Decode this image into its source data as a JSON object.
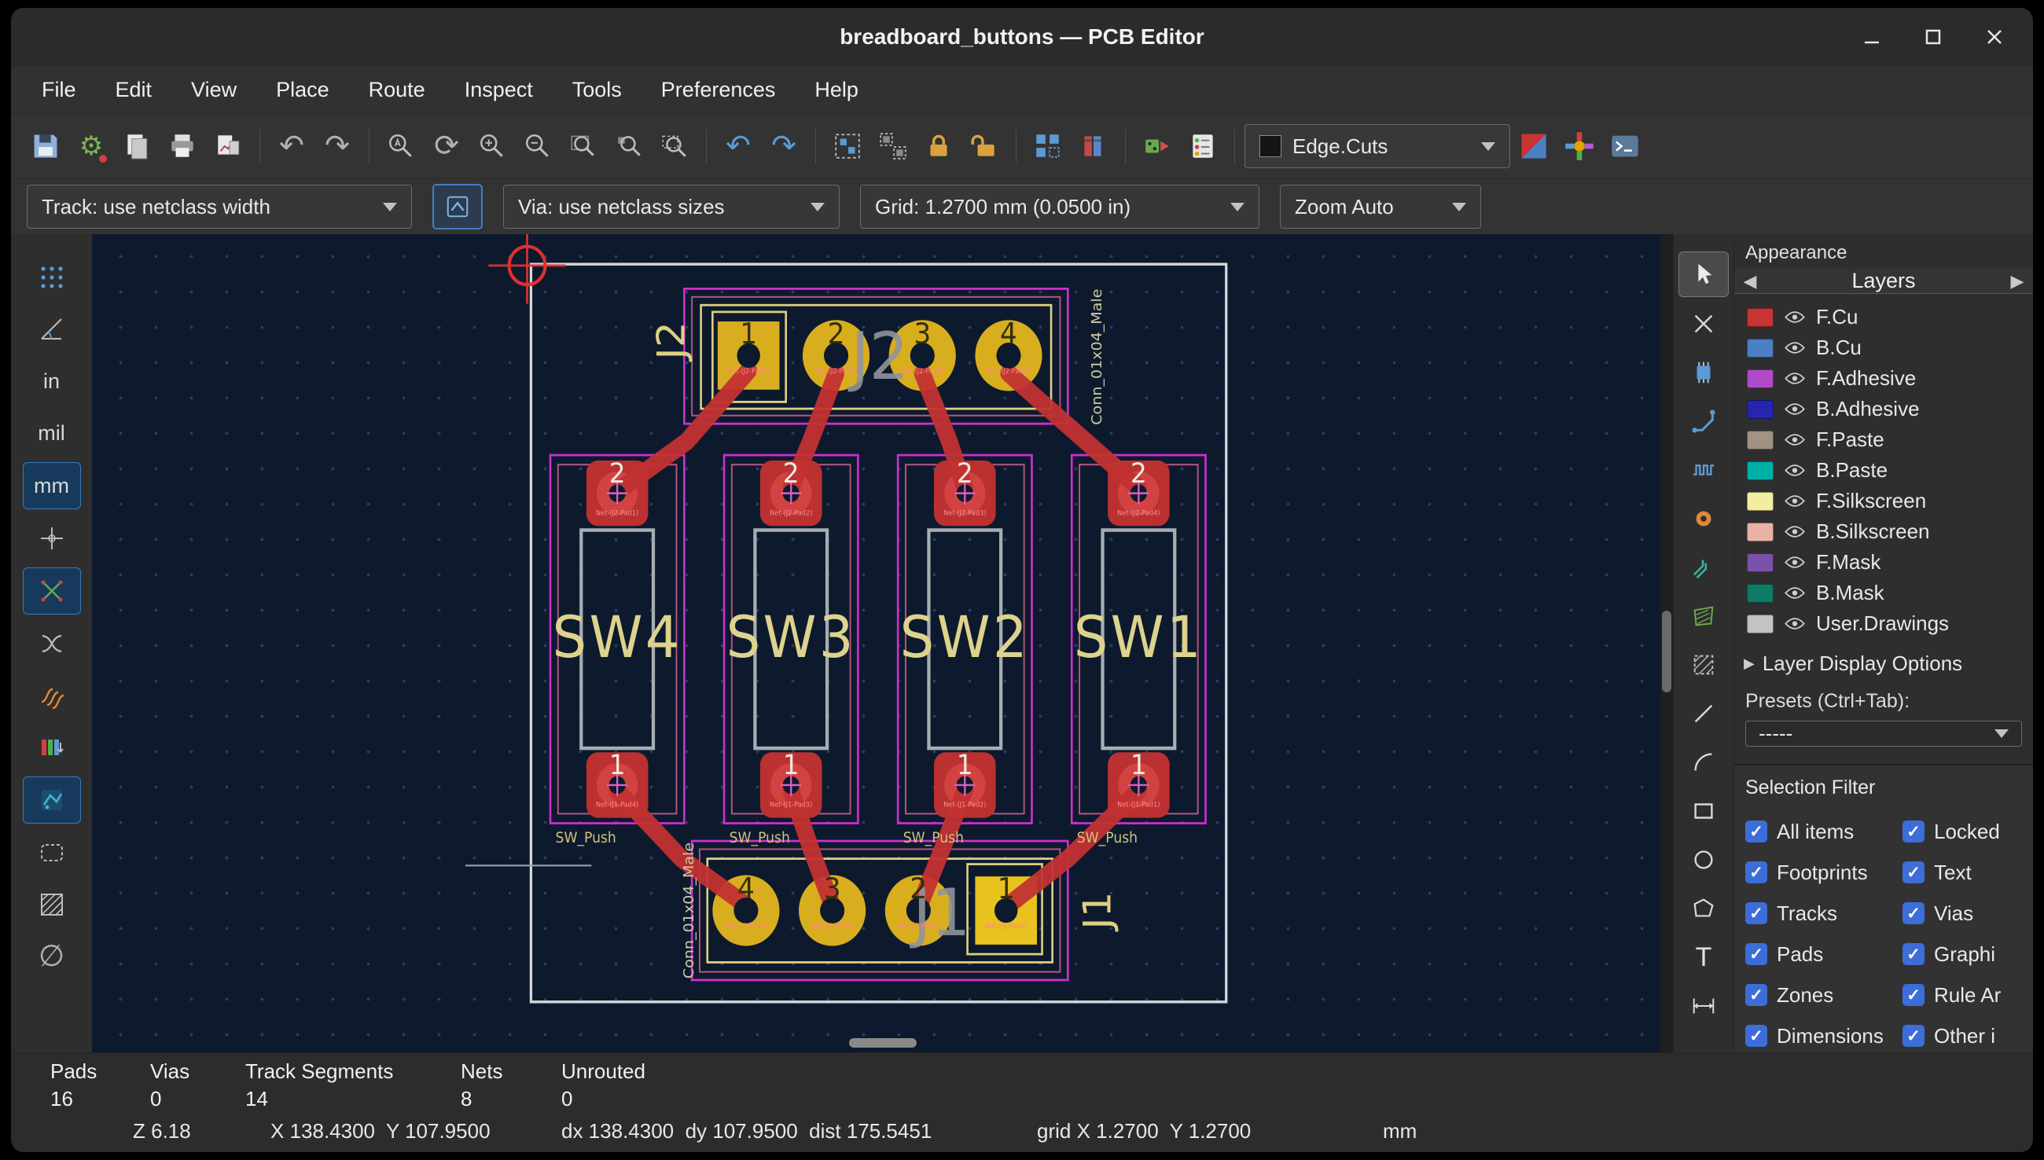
{
  "window": {
    "title": "breadboard_buttons — PCB Editor"
  },
  "menu": {
    "items": [
      "File",
      "Edit",
      "View",
      "Place",
      "Route",
      "Inspect",
      "Tools",
      "Preferences",
      "Help"
    ]
  },
  "toolbar": {
    "active_layer": "Edge.Cuts",
    "active_layer_color": "#141414"
  },
  "toolbar2": {
    "track": "Track: use netclass width",
    "via": "Via: use netclass sizes",
    "grid": "Grid: 1.2700 mm (0.0500 in)",
    "zoom": "Zoom Auto"
  },
  "left_toolbar": {
    "in": "in",
    "mil": "mil",
    "mm": "mm"
  },
  "icons": {
    "check": "✓",
    "tab_prev": "◀",
    "tab_next": "▶",
    "expander": "▶",
    "gear": "⚙",
    "undo": "↶",
    "redo": "↷",
    "refresh": "⟳",
    "zone_hide": "∅",
    "text_tool": "T"
  },
  "appearance": {
    "title": "Appearance",
    "tab": "Layers",
    "layers": [
      {
        "name": "F.Cu",
        "color": "#c83434"
      },
      {
        "name": "B.Cu",
        "color": "#4d7fc4"
      },
      {
        "name": "F.Adhesive",
        "color": "#af4bc9"
      },
      {
        "name": "B.Adhesive",
        "color": "#2525b0"
      },
      {
        "name": "F.Paste",
        "color": "#a09383"
      },
      {
        "name": "B.Paste",
        "color": "#00b0a8"
      },
      {
        "name": "F.Silkscreen",
        "color": "#f2eda1"
      },
      {
        "name": "B.Silkscreen",
        "color": "#e8b2a7"
      },
      {
        "name": "F.Mask",
        "color": "#7b52ab"
      },
      {
        "name": "B.Mask",
        "color": "#0f7a68"
      },
      {
        "name": "User.Drawings",
        "color": "#c2c2c2"
      }
    ],
    "layer_display_options": "Layer Display Options",
    "presets_label": "Presets (Ctrl+Tab):",
    "presets_value": "-----",
    "selection_filter": {
      "title": "Selection Filter",
      "items": [
        {
          "label": "All items",
          "checked": true
        },
        {
          "label": "Locked",
          "checked": true
        },
        {
          "label": "Footprints",
          "checked": true
        },
        {
          "label": "Text",
          "checked": true
        },
        {
          "label": "Tracks",
          "checked": true
        },
        {
          "label": "Vias",
          "checked": true
        },
        {
          "label": "Pads",
          "checked": true
        },
        {
          "label": "Graphi",
          "checked": true
        },
        {
          "label": "Zones",
          "checked": true
        },
        {
          "label": "Rule Ar",
          "checked": true
        },
        {
          "label": "Dimensions",
          "checked": true
        },
        {
          "label": "Other i",
          "checked": true
        }
      ]
    }
  },
  "pcb": {
    "refs": {
      "j1": "J1",
      "j2": "J2",
      "sw_refs": [
        "SW4",
        "SW3",
        "SW2",
        "SW1"
      ]
    },
    "footprints": {
      "connector": "Conn_01x04_Male",
      "switch": "SW_Push"
    },
    "pad_numbers": [
      "1",
      "2",
      "3",
      "4"
    ],
    "nets_j2": [
      "Net-(J2-Pad1)",
      "Net-(J2-Pad2)",
      "Net-(J2-Pad3)",
      "Net-(J2-Pad4)"
    ],
    "nets_j1": [
      "Net-(J1-Pad1)",
      "Net-(J1-Pad2)",
      "Net-(J1-Pad3)",
      "Net-(J1-Pad4)"
    ]
  },
  "status": {
    "row1": [
      {
        "label": "Pads",
        "value": "16"
      },
      {
        "label": "Vias",
        "value": "0"
      },
      {
        "label": "Track Segments",
        "value": "14"
      },
      {
        "label": "Nets",
        "value": "8"
      },
      {
        "label": "Unrouted",
        "value": "0"
      }
    ],
    "row2": {
      "zoom": "Z 6.18",
      "xy": "X 138.4300  Y 107.9500",
      "dxy": "dx 138.4300  dy 107.9500  dist 175.5451",
      "grid": "grid X 1.2700  Y 1.2700",
      "units": "mm"
    }
  }
}
